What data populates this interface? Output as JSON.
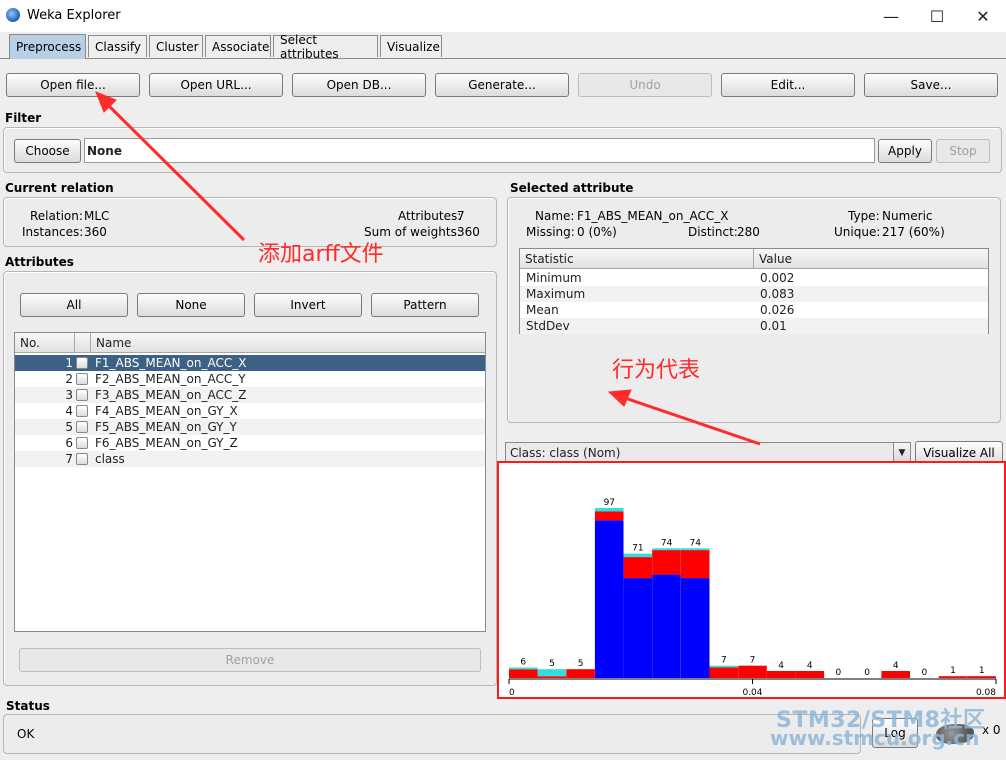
{
  "window": {
    "title": "Weka Explorer",
    "minimize": "—",
    "maximize": "☐",
    "close": "✕"
  },
  "tabs": [
    "Preprocess",
    "Classify",
    "Cluster",
    "Associate",
    "Select attributes",
    "Visualize"
  ],
  "toolbar": {
    "open_file": "Open file...",
    "open_url": "Open URL...",
    "open_db": "Open DB...",
    "generate": "Generate...",
    "undo": "Undo",
    "edit": "Edit...",
    "save": "Save..."
  },
  "filter": {
    "label": "Filter",
    "choose": "Choose",
    "value": "None",
    "apply": "Apply",
    "stop": "Stop"
  },
  "relation": {
    "label": "Current relation",
    "relation_key": "Relation:",
    "relation_val": "MLC",
    "instances_key": "Instances:",
    "instances_val": "360",
    "attributes_key": "Attributes:",
    "attributes_val": "7",
    "sumw_key": "Sum of weights:",
    "sumw_val": "360"
  },
  "attributes": {
    "label": "Attributes",
    "buttons": {
      "all": "All",
      "none": "None",
      "invert": "Invert",
      "pattern": "Pattern"
    },
    "headers": {
      "no": "No.",
      "name": "Name"
    },
    "rows": [
      {
        "no": "1",
        "name": "F1_ABS_MEAN_on_ACC_X"
      },
      {
        "no": "2",
        "name": "F2_ABS_MEAN_on_ACC_Y"
      },
      {
        "no": "3",
        "name": "F3_ABS_MEAN_on_ACC_Z"
      },
      {
        "no": "4",
        "name": "F4_ABS_MEAN_on_GY_X"
      },
      {
        "no": "5",
        "name": "F5_ABS_MEAN_on_GY_Y"
      },
      {
        "no": "6",
        "name": "F6_ABS_MEAN_on_GY_Z"
      },
      {
        "no": "7",
        "name": "class"
      }
    ],
    "remove": "Remove"
  },
  "selected": {
    "label": "Selected attribute",
    "name_key": "Name:",
    "name_val": "F1_ABS_MEAN_on_ACC_X",
    "type_key": "Type:",
    "type_val": "Numeric",
    "missing_key": "Missing:",
    "missing_val": "0 (0%)",
    "distinct_key": "Distinct:",
    "distinct_val": "280",
    "unique_key": "Unique:",
    "unique_val": "217 (60%)",
    "headers": {
      "stat": "Statistic",
      "value": "Value"
    },
    "stats": [
      {
        "stat": "Minimum",
        "value": "0.002"
      },
      {
        "stat": "Maximum",
        "value": "0.083"
      },
      {
        "stat": "Mean",
        "value": "0.026"
      },
      {
        "stat": "StdDev",
        "value": "0.01"
      }
    ]
  },
  "class_combo": {
    "value": "Class: class (Nom)",
    "visualize_all": "Visualize All"
  },
  "chart_data": {
    "type": "bar",
    "x_ticks": [
      "0",
      "0.04",
      "0.08"
    ],
    "colors": {
      "blue": "#0000ff",
      "red": "#ff0000",
      "cyan": "#33dddd"
    },
    "bins": [
      {
        "label": "6",
        "blue": 0,
        "red": 5,
        "cyan": 1
      },
      {
        "label": "5",
        "blue": 0,
        "red": 1,
        "cyan": 4
      },
      {
        "label": "5",
        "blue": 0,
        "red": 5,
        "cyan": 0
      },
      {
        "label": "97",
        "blue": 90,
        "red": 5,
        "cyan": 2
      },
      {
        "label": "71",
        "blue": 57,
        "red": 12,
        "cyan": 2
      },
      {
        "label": "74",
        "blue": 59,
        "red": 14,
        "cyan": 1
      },
      {
        "label": "74",
        "blue": 57,
        "red": 16,
        "cyan": 1
      },
      {
        "label": "7",
        "blue": 0,
        "red": 6,
        "cyan": 1
      },
      {
        "label": "7",
        "blue": 0,
        "red": 7,
        "cyan": 0
      },
      {
        "label": "4",
        "blue": 0,
        "red": 4,
        "cyan": 0
      },
      {
        "label": "4",
        "blue": 0,
        "red": 4,
        "cyan": 0
      },
      {
        "label": "0",
        "blue": 0,
        "red": 0,
        "cyan": 0
      },
      {
        "label": "0",
        "blue": 0,
        "red": 0,
        "cyan": 0
      },
      {
        "label": "4",
        "blue": 0,
        "red": 4,
        "cyan": 0
      },
      {
        "label": "0",
        "blue": 0,
        "red": 0,
        "cyan": 0
      },
      {
        "label": "1",
        "blue": 0,
        "red": 1,
        "cyan": 0
      },
      {
        "label": "1",
        "blue": 0,
        "red": 1,
        "cyan": 0
      }
    ]
  },
  "annotations": {
    "arff": "添加arff文件",
    "behavior": "行为代表"
  },
  "status": {
    "label": "Status",
    "text": "OK",
    "log": "Log",
    "tasks": "x 0"
  },
  "watermark": {
    "line1": "STM32/STM8社区",
    "line2": "www.stmcu.org.cn"
  }
}
